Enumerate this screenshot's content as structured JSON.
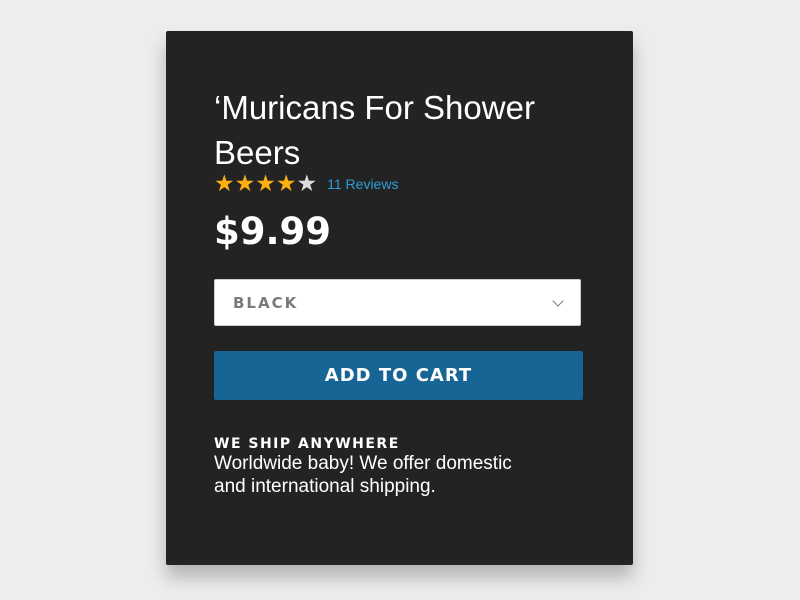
{
  "product": {
    "title": "‘Muricans For Shower Beers",
    "rating": 4,
    "rating_max": 5,
    "reviews_label": "11 Reviews",
    "price": "$9.99"
  },
  "variant_select": {
    "selected": "BLACK"
  },
  "add_to_cart_label": "ADD TO CART",
  "shipping": {
    "heading": "WE SHIP ANYWHERE",
    "text": "Worldwide baby! We offer domestic and international shipping."
  },
  "colors": {
    "star": "#fbb00f",
    "star_empty": "#dcdcdc",
    "link": "#2d9fd9",
    "button": "#176594",
    "card": "#232323"
  }
}
